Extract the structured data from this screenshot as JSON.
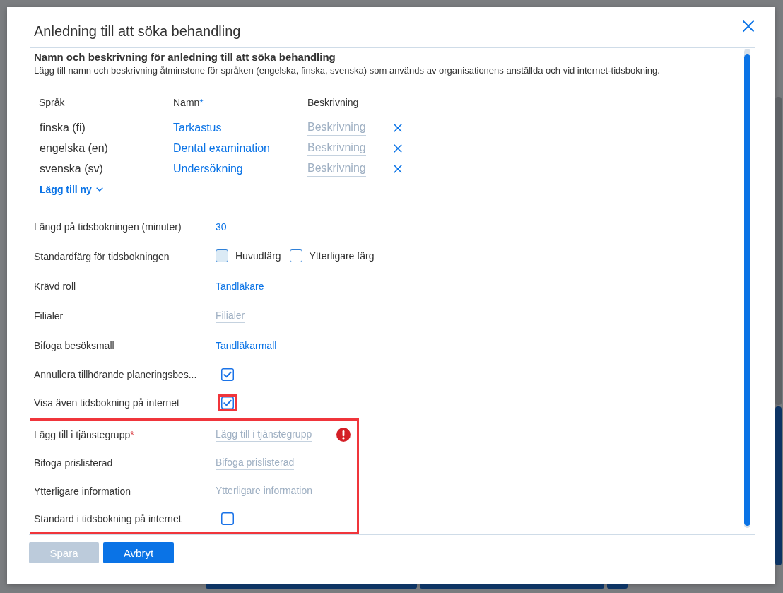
{
  "dialog": {
    "title": "Anledning till att söka behandling"
  },
  "names_section": {
    "heading": "Namn och beskrivning för anledning till att söka behandling",
    "description": "Lägg till namn och beskrivning åtminstone för språken (engelska, finska, svenska) som används av organisationens anställda och vid internet-tidsbokning.",
    "columns": [
      {
        "label": "Språk"
      },
      {
        "label": "Namn",
        "required_mark": "*"
      },
      {
        "label": "Beskrivning"
      }
    ],
    "rows": [
      {
        "language": "finska (fi)",
        "name": "Tarkastus",
        "description": {
          "placeholder": "Beskrivning"
        }
      },
      {
        "language": "engelska (en)",
        "name": "Dental examination",
        "description": {
          "placeholder": "Beskrivning"
        }
      },
      {
        "language": "svenska (sv)",
        "name": "Undersökning",
        "description": {
          "placeholder": "Beskrivning"
        }
      }
    ],
    "add_button": {
      "label": "Lägg till ny"
    }
  },
  "sections": [
    {
      "highlighted": false,
      "fields": [
        {
          "kind": "value",
          "label": "Längd på tidsbokningen (minuter)",
          "value": "30"
        },
        {
          "kind": "colors",
          "label": "Standardfärg för tidsbokningen",
          "options": [
            {
              "label": "Huvudfärg",
              "color": "#dbeaf5"
            },
            {
              "label": "Ytterligare färg",
              "color": "#ffffff"
            }
          ]
        },
        {
          "kind": "value",
          "label": "Krävd roll",
          "value": "Tandläkare"
        },
        {
          "kind": "input",
          "label": "Filialer",
          "placeholder": "Filialer",
          "error": false
        },
        {
          "kind": "value",
          "label": "Bifoga besöksmall",
          "value": "Tandläkarmall"
        },
        {
          "kind": "checkbox",
          "label": "Annullera tillhörande planeringsbes...",
          "checked": true,
          "highlighted": false
        },
        {
          "kind": "checkbox",
          "label": "Visa även tidsbokning på internet",
          "checked": true,
          "highlighted": true
        }
      ]
    },
    {
      "highlighted": true,
      "fields": [
        {
          "kind": "input",
          "label": "Lägg till i tjänstegrupp",
          "required_mark": "*",
          "placeholder": "Lägg till i tjänstegrupp",
          "error": true
        },
        {
          "kind": "input",
          "label": "Bifoga prislisterad",
          "placeholder": "Bifoga prislisterad",
          "error": false
        },
        {
          "kind": "input",
          "label": "Ytterligare information",
          "placeholder": "Ytterligare information",
          "error": false
        },
        {
          "kind": "checkbox",
          "label": "Standard i tidsbokning på internet",
          "checked": false,
          "highlighted": false
        }
      ]
    }
  ],
  "buttons": [
    {
      "label": "Spara",
      "disabled": true
    },
    {
      "label": "Avbryt",
      "disabled": false
    }
  ]
}
